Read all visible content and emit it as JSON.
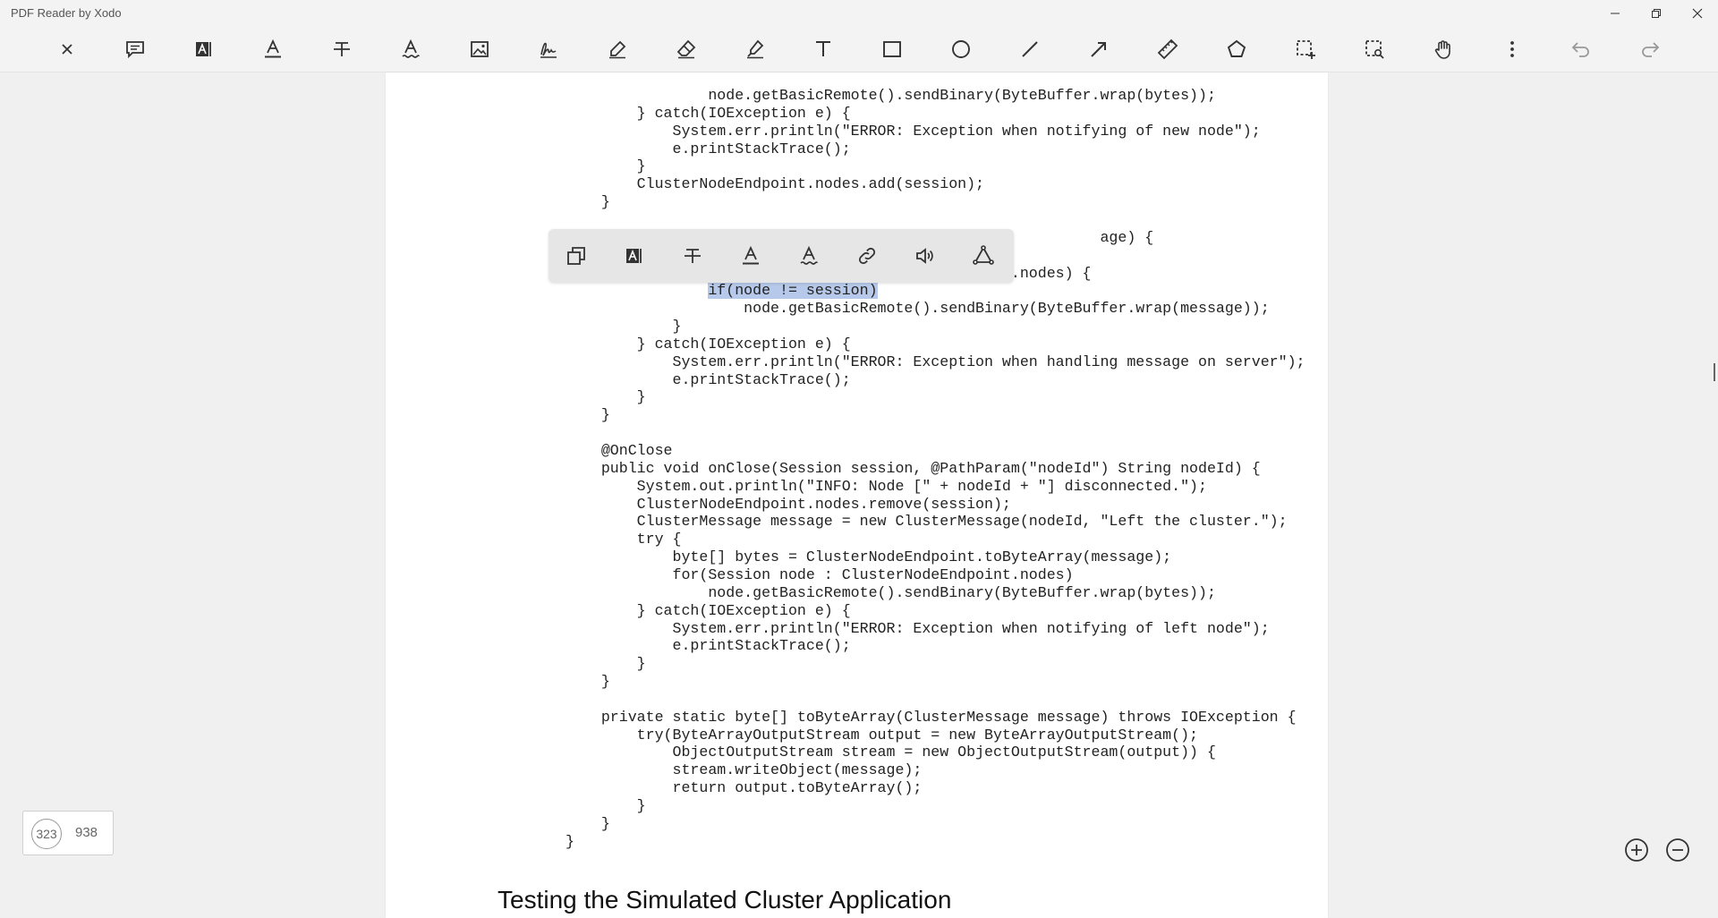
{
  "window": {
    "title": "PDF Reader by Xodo"
  },
  "toolbar": {
    "tools": [
      {
        "name": "close-icon"
      },
      {
        "name": "comment-icon"
      },
      {
        "name": "text-highlight-icon"
      },
      {
        "name": "text-underline-icon"
      },
      {
        "name": "text-strikeout-icon"
      },
      {
        "name": "text-squiggly-icon"
      },
      {
        "name": "image-icon"
      },
      {
        "name": "signature-icon"
      },
      {
        "name": "pen-icon"
      },
      {
        "name": "eraser-icon"
      },
      {
        "name": "highlighter-icon"
      },
      {
        "name": "text-box-icon"
      },
      {
        "name": "rectangle-icon"
      },
      {
        "name": "ellipse-icon"
      },
      {
        "name": "line-icon"
      },
      {
        "name": "arrow-icon"
      },
      {
        "name": "ruler-icon"
      },
      {
        "name": "polygon-icon"
      },
      {
        "name": "area-select-icon"
      },
      {
        "name": "zoom-select-icon"
      },
      {
        "name": "pan-hand-icon"
      },
      {
        "name": "more-icon"
      },
      {
        "name": "undo-icon"
      },
      {
        "name": "redo-icon"
      }
    ]
  },
  "selection_popup": {
    "items": [
      "copy-icon",
      "highlight-icon",
      "strikeout-icon",
      "underline-icon",
      "squiggly-icon",
      "link-icon",
      "read-aloud-icon",
      "search-web-icon"
    ]
  },
  "document": {
    "code_lines": [
      "                node.getBasicRemote().sendBinary(ByteBuffer.wrap(bytes));",
      "        } catch(IOException e) {",
      "            System.err.println(\"ERROR: Exception when notifying of new node\");",
      "            e.printStackTrace();",
      "        }",
      "        ClusterNodeEndpoint.nodes.add(session);",
      "    }",
      "",
      "                                                            age) {",
      "",
      "            for(Session node : ClusterNodeEndpoint.nodes) {",
      "                if(node != session)",
      "                    node.getBasicRemote().sendBinary(ByteBuffer.wrap(message));",
      "            }",
      "        } catch(IOException e) {",
      "            System.err.println(\"ERROR: Exception when handling message on server\");",
      "            e.printStackTrace();",
      "        }",
      "    }",
      "",
      "    @OnClose",
      "    public void onClose(Session session, @PathParam(\"nodeId\") String nodeId) {",
      "        System.out.println(\"INFO: Node [\" + nodeId + \"] disconnected.\");",
      "        ClusterNodeEndpoint.nodes.remove(session);",
      "        ClusterMessage message = new ClusterMessage(nodeId, \"Left the cluster.\");",
      "        try {",
      "            byte[] bytes = ClusterNodeEndpoint.toByteArray(message);",
      "            for(Session node : ClusterNodeEndpoint.nodes)",
      "                node.getBasicRemote().sendBinary(ByteBuffer.wrap(bytes));",
      "        } catch(IOException e) {",
      "            System.err.println(\"ERROR: Exception when notifying of left node\");",
      "            e.printStackTrace();",
      "        }",
      "    }",
      "",
      "    private static byte[] toByteArray(ClusterMessage message) throws IOException {",
      "        try(ByteArrayOutputStream output = new ByteArrayOutputStream();",
      "            ObjectOutputStream stream = new ObjectOutputStream(output)) {",
      "            stream.writeObject(message);",
      "            return output.toByteArray();",
      "        }",
      "    }",
      "}"
    ],
    "selected_text": "if(node != session)",
    "heading": "Testing the Simulated Cluster Application"
  },
  "page_indicator": {
    "current": "323",
    "total": "938"
  },
  "zoom": {
    "in": "zoom-in-icon",
    "out": "zoom-out-icon"
  }
}
